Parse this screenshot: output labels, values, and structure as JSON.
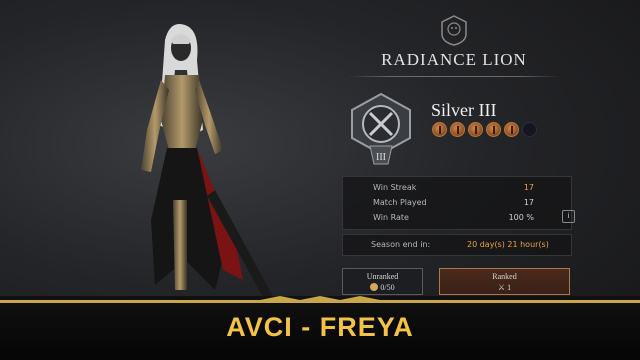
{
  "faction": {
    "title": "RADIANCE LION",
    "emblem_icon": "lion-head-icon"
  },
  "rank": {
    "name": "Silver III",
    "badge_numeral": "III",
    "pips_filled": 5,
    "pips_total": 6
  },
  "stats": [
    {
      "label": "Win Streak",
      "value": "17",
      "color": "#e9a14a"
    },
    {
      "label": "Match Played",
      "value": "17",
      "color": "#cfcfcf"
    },
    {
      "label": "Win Rate",
      "value": "100 %",
      "color": "#cfcfcf"
    }
  ],
  "season": {
    "label": "Season end in:",
    "value": "20 day(s) 21 hour(s)"
  },
  "buttons": {
    "unranked": {
      "label": "Unranked",
      "count": "0/50"
    },
    "ranked": {
      "label": "Ranked",
      "count": "1"
    }
  },
  "banner": {
    "text": "AVCI - FREYA"
  },
  "colors": {
    "accent_orange": "#e9a14a",
    "banner_gold": "#f2c347",
    "ranked_border": "#a77a4a"
  }
}
